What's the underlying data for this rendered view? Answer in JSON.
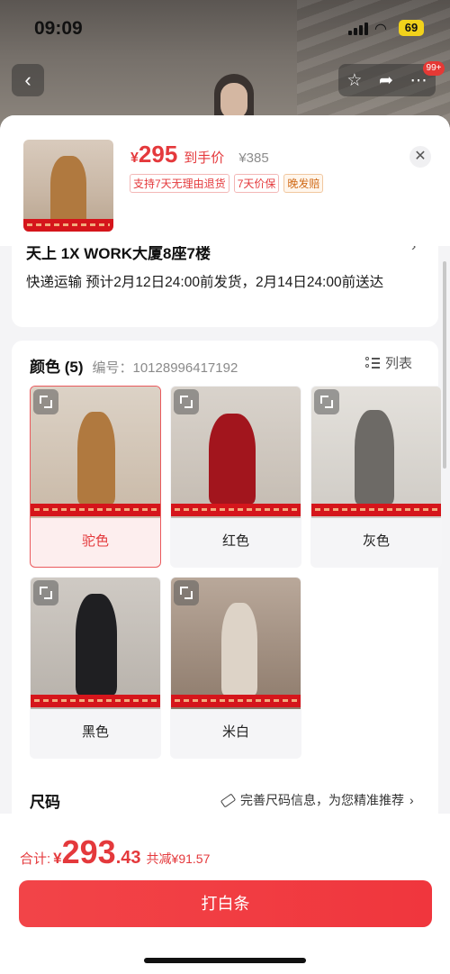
{
  "status_bar": {
    "time": "09:09",
    "battery": "69"
  },
  "nav": {
    "badge": "99+"
  },
  "product": {
    "price_symbol": "¥",
    "price": "295",
    "price_label": "到手价",
    "original_price": "¥385",
    "tags": [
      "支持7天无理由退货",
      "7天价保",
      "晚发赔"
    ]
  },
  "delivery": {
    "address_partial": "天上 1X WORK大厦8座7楼",
    "info": "快递运输 预计2月12日24:00前发货，2月14日24:00前送达"
  },
  "color_section": {
    "title": "颜色 (5)",
    "code_label": "编号：10128996417192",
    "list_label": "列表",
    "options": [
      {
        "label": "驼色",
        "selected": true
      },
      {
        "label": "红色",
        "selected": false
      },
      {
        "label": "灰色",
        "selected": false
      },
      {
        "label": "黑色",
        "selected": false
      },
      {
        "label": "米白",
        "selected": false
      }
    ]
  },
  "size_section": {
    "title": "尺码",
    "hint": "完善尺码信息，为您精准推荐"
  },
  "footer": {
    "total_label": "合计:",
    "total_yen": "¥",
    "total_int": "293",
    "total_dec": ".43",
    "savings": "共减¥91.57",
    "pay_button": "打白条"
  },
  "colors": {
    "accent": "#e4393c",
    "button": "#f0363d"
  }
}
